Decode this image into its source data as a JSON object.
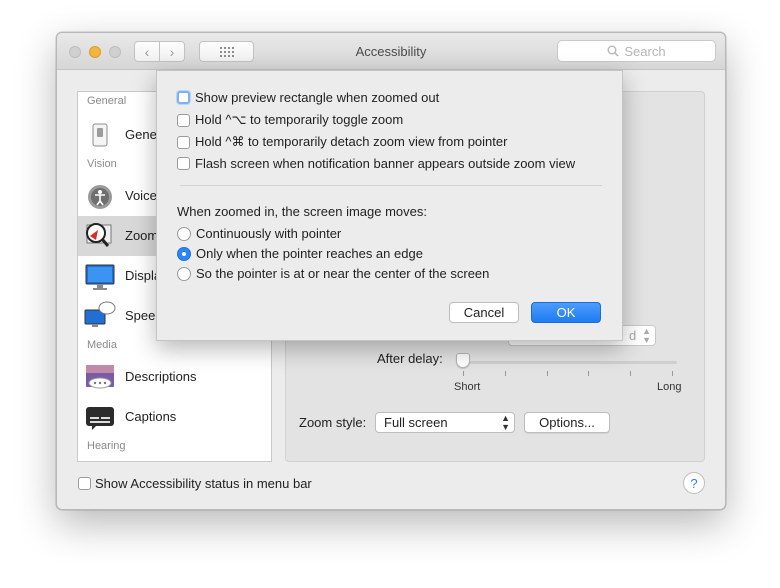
{
  "window": {
    "title": "Accessibility",
    "search_placeholder": "Search"
  },
  "sidebar": {
    "headers": {
      "general": "General",
      "vision": "Vision",
      "media": "Media",
      "hearing": "Hearing"
    },
    "items": [
      {
        "label": "General",
        "icon": "general-icon",
        "selected": false
      },
      {
        "label": "VoiceOver",
        "icon": "voiceover-icon",
        "selected": false
      },
      {
        "label": "Zoom",
        "icon": "zoom-magnifier-icon",
        "selected": true
      },
      {
        "label": "Display",
        "icon": "display-icon",
        "selected": false
      },
      {
        "label": "Speech",
        "icon": "speech-icon",
        "selected": false
      },
      {
        "label": "Descriptions",
        "icon": "descriptions-icon",
        "selected": false
      },
      {
        "label": "Captions",
        "icon": "captions-icon",
        "selected": false
      }
    ]
  },
  "pane": {
    "after_delay_label": "After delay:",
    "slider_min_label": "Short",
    "slider_max_label": "Long",
    "slider_value": 0,
    "zoom_style_label": "Zoom style:",
    "zoom_style_value": "Full screen",
    "options_button": "Options...",
    "partial_select_text": "d"
  },
  "bottom": {
    "menu_bar_checkbox_label": "Show Accessibility status in menu bar",
    "menu_bar_checked": false,
    "help_label": "?"
  },
  "sheet": {
    "checkboxes": [
      {
        "label": "Show preview rectangle when zoomed out",
        "checked": false,
        "focused": true
      },
      {
        "label": "Hold ^⌥ to temporarily toggle zoom",
        "checked": false
      },
      {
        "label": "Hold ^⌘ to temporarily detach zoom view from pointer",
        "checked": false
      },
      {
        "label": "Flash screen when notification banner appears outside zoom view",
        "checked": false
      }
    ],
    "moves_label": "When zoomed in, the screen image moves:",
    "radios": [
      {
        "label": "Continuously with pointer",
        "selected": false
      },
      {
        "label": "Only when the pointer reaches an edge",
        "selected": true
      },
      {
        "label": "So the pointer is at or near the center of the screen",
        "selected": false
      }
    ],
    "cancel_label": "Cancel",
    "ok_label": "OK"
  },
  "colors": {
    "accent": "#2a86f5",
    "window_bg": "#ececec"
  }
}
